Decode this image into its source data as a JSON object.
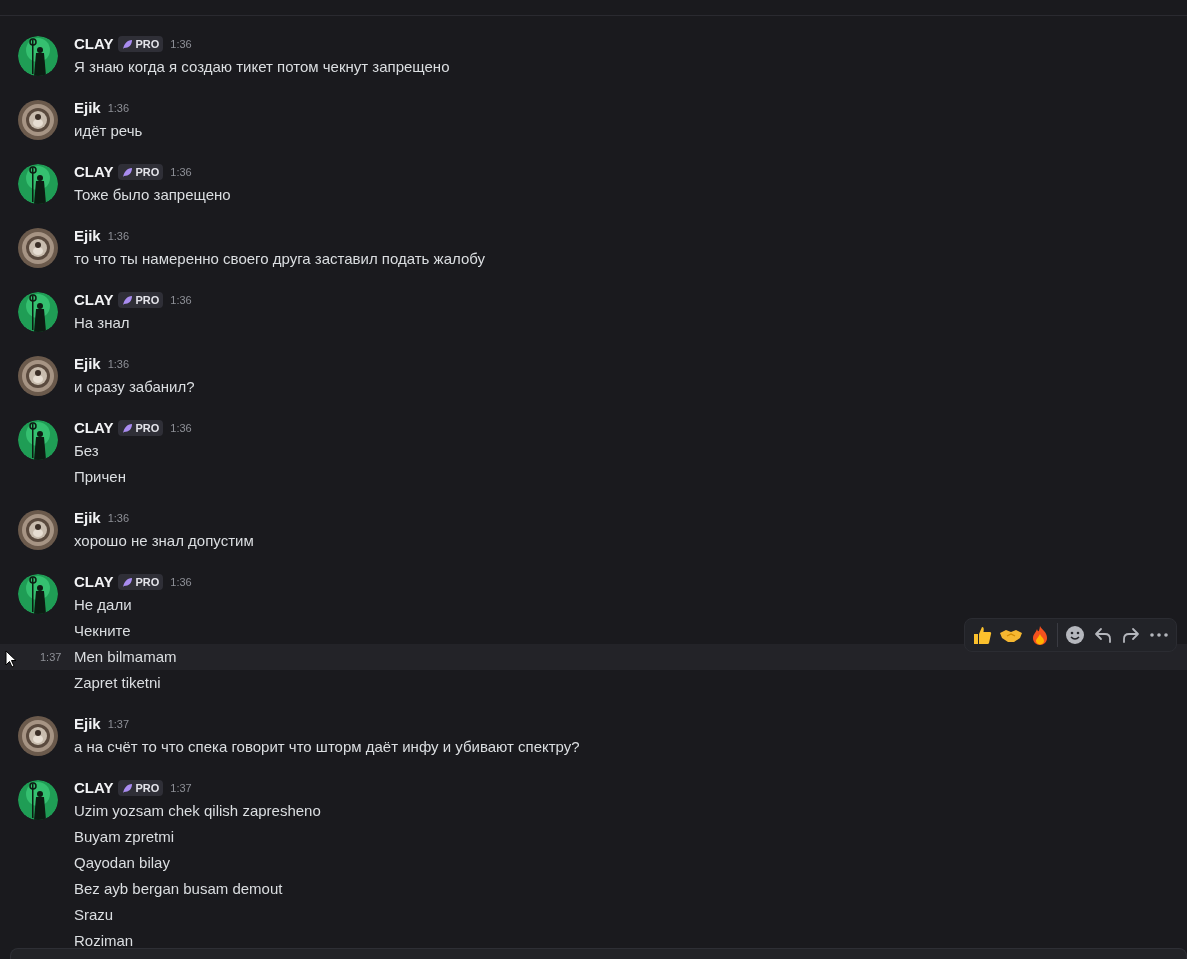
{
  "messages": [
    {
      "author": "CLAY",
      "kind": "clay",
      "badge": "PRO",
      "time": "1:36",
      "lines": [
        {
          "text": "Я знаю когда я создаю тикет потом чекнут запрещено",
          "hovered": false
        }
      ]
    },
    {
      "author": "Ejik",
      "kind": "ejik",
      "time": "1:36",
      "lines": [
        {
          "text": "идёт речь",
          "hovered": false
        }
      ]
    },
    {
      "author": "CLAY",
      "kind": "clay",
      "badge": "PRO",
      "time": "1:36",
      "lines": [
        {
          "text": "Тоже было запрещено",
          "hovered": false
        }
      ]
    },
    {
      "author": "Ejik",
      "kind": "ejik",
      "time": "1:36",
      "lines": [
        {
          "text": "то что ты намеренно своего друга заставил подать жалобу",
          "hovered": false
        }
      ]
    },
    {
      "author": "CLAY",
      "kind": "clay",
      "badge": "PRO",
      "time": "1:36",
      "lines": [
        {
          "text": "На знал",
          "hovered": false
        }
      ]
    },
    {
      "author": "Ejik",
      "kind": "ejik",
      "time": "1:36",
      "lines": [
        {
          "text": "и сразу забанил?",
          "hovered": false
        }
      ]
    },
    {
      "author": "CLAY",
      "kind": "clay",
      "badge": "PRO",
      "time": "1:36",
      "lines": [
        {
          "text": "Без",
          "hovered": false
        },
        {
          "text": "Причен",
          "hovered": false
        }
      ]
    },
    {
      "author": "Ejik",
      "kind": "ejik",
      "time": "1:36",
      "lines": [
        {
          "text": "хорошо не знал допустим",
          "hovered": false
        }
      ]
    },
    {
      "author": "CLAY",
      "kind": "clay",
      "badge": "PRO",
      "time": "1:36",
      "lines": [
        {
          "text": "Не дали",
          "hovered": false
        },
        {
          "text": "Чекните",
          "hovered": false
        },
        {
          "text": "Men bilmamam",
          "hovered": true,
          "time": "1:37"
        },
        {
          "text": "Zapret tiketni",
          "hovered": false
        }
      ]
    },
    {
      "author": "Ejik",
      "kind": "ejik",
      "time": "1:37",
      "lines": [
        {
          "text": "а на счёт то что спека говорит что шторм даёт инфу и убивают спектру?",
          "hovered": false
        }
      ]
    },
    {
      "author": "CLAY",
      "kind": "clay",
      "badge": "PRO",
      "time": "1:37",
      "lines": [
        {
          "text": "Uzim yozsam chek qilish zapresheno",
          "hovered": false
        },
        {
          "text": "Buyam zpretmi",
          "hovered": false
        },
        {
          "text": "Qayodan bilay",
          "hovered": false
        },
        {
          "text": "Bez ayb bergan busam demout",
          "hovered": false
        },
        {
          "text": "Srazu",
          "hovered": false
        },
        {
          "text": "Roziman",
          "hovered": false
        }
      ]
    }
  ]
}
